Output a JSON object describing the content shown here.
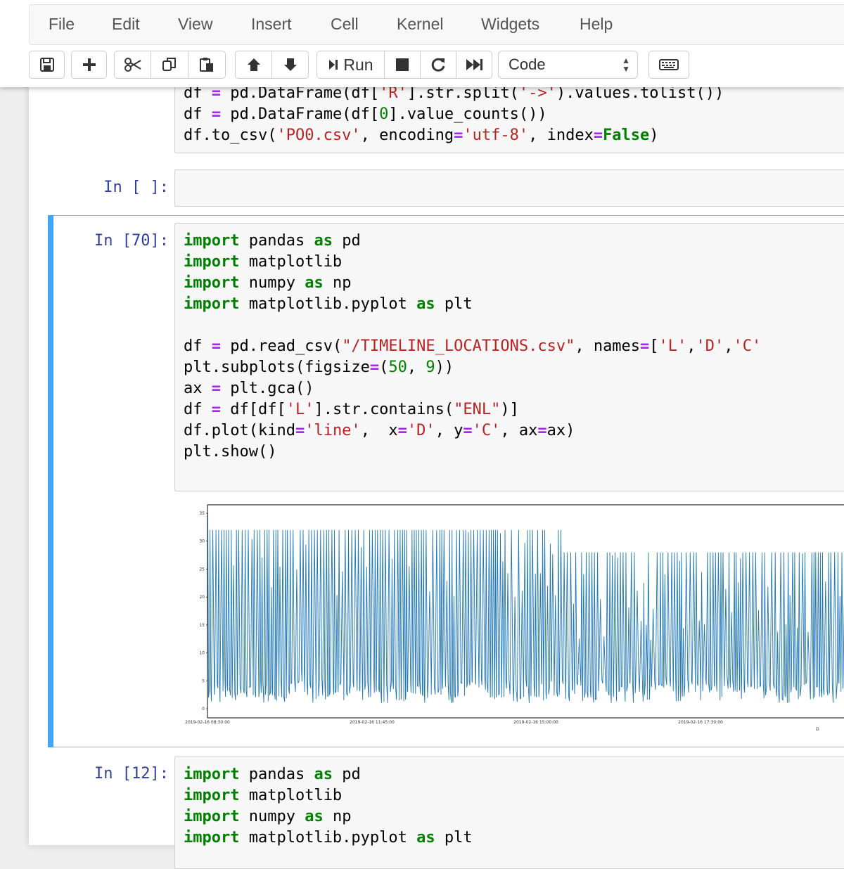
{
  "menu": [
    "File",
    "Edit",
    "View",
    "Insert",
    "Cell",
    "Kernel",
    "Widgets",
    "Help"
  ],
  "toolbar": {
    "run_label": "Run",
    "cell_type": "Code"
  },
  "icons": [
    "save-icon",
    "plus-icon",
    "cut-icon",
    "copy-icon",
    "paste-icon",
    "arrow-up-icon",
    "arrow-down-icon",
    "step-icon",
    "stop-icon",
    "restart-icon",
    "fast-forward-icon",
    "keyboard-icon"
  ],
  "cells": [
    {
      "prompt": "",
      "lines": [
        [
          [
            "t",
            "df "
          ],
          [
            "op",
            "="
          ],
          [
            "t",
            " pd.DataFrame(df["
          ],
          [
            "str",
            "'R'"
          ],
          [
            "t",
            "].str.split("
          ],
          [
            "str",
            "'->'"
          ],
          [
            "t",
            ").values.tolist())"
          ]
        ],
        [
          [
            "t",
            "df "
          ],
          [
            "op",
            "="
          ],
          [
            "t",
            " pd.DataFrame(df["
          ],
          [
            "num",
            "0"
          ],
          [
            "t",
            "].value_counts())"
          ]
        ],
        [
          [
            "t",
            "df.to_csv("
          ],
          [
            "str",
            "'PO0.csv'"
          ],
          [
            "t",
            ", encoding"
          ],
          [
            "op",
            "="
          ],
          [
            "str",
            "'utf-8'"
          ],
          [
            "t",
            ", index"
          ],
          [
            "op",
            "="
          ],
          [
            "kwc",
            "False"
          ],
          [
            "t",
            ")"
          ]
        ]
      ]
    },
    {
      "prompt": "In [ ]:",
      "lines": []
    },
    {
      "prompt": "In [70]:",
      "lines": [
        [
          [
            "kw",
            "import"
          ],
          [
            "t",
            " pandas "
          ],
          [
            "kw",
            "as"
          ],
          [
            "t",
            " pd"
          ]
        ],
        [
          [
            "kw",
            "import"
          ],
          [
            "t",
            " matplotlib"
          ]
        ],
        [
          [
            "kw",
            "import"
          ],
          [
            "t",
            " numpy "
          ],
          [
            "kw",
            "as"
          ],
          [
            "t",
            " np"
          ]
        ],
        [
          [
            "kw",
            "import"
          ],
          [
            "t",
            " matplotlib.pyplot "
          ],
          [
            "kw",
            "as"
          ],
          [
            "t",
            " plt"
          ]
        ],
        [
          [
            "t",
            ""
          ]
        ],
        [
          [
            "t",
            "df "
          ],
          [
            "op",
            "="
          ],
          [
            "t",
            " pd.read_csv("
          ],
          [
            "str",
            "\"/TIMELINE_LOCATIONS.csv\""
          ],
          [
            "t",
            ", names"
          ],
          [
            "op",
            "="
          ],
          [
            "t",
            "["
          ],
          [
            "str",
            "'L'"
          ],
          [
            "t",
            ","
          ],
          [
            "str",
            "'D'"
          ],
          [
            "t",
            ","
          ],
          [
            "str",
            "'C'"
          ]
        ],
        [
          [
            "t",
            "plt.subplots(figsize"
          ],
          [
            "op",
            "="
          ],
          [
            "t",
            "("
          ],
          [
            "num",
            "50"
          ],
          [
            "t",
            ", "
          ],
          [
            "num",
            "9"
          ],
          [
            "t",
            "))"
          ]
        ],
        [
          [
            "t",
            "ax "
          ],
          [
            "op",
            "="
          ],
          [
            "t",
            " plt.gca()"
          ]
        ],
        [
          [
            "t",
            "df "
          ],
          [
            "op",
            "="
          ],
          [
            "t",
            " df[df["
          ],
          [
            "str",
            "'L'"
          ],
          [
            "t",
            "].str.contains("
          ],
          [
            "str",
            "\"ENL\""
          ],
          [
            "t",
            ")]"
          ]
        ],
        [
          [
            "t",
            "df.plot(kind"
          ],
          [
            "op",
            "="
          ],
          [
            "str",
            "'line'"
          ],
          [
            "t",
            ",  x"
          ],
          [
            "op",
            "="
          ],
          [
            "str",
            "'D'"
          ],
          [
            "t",
            ", y"
          ],
          [
            "op",
            "="
          ],
          [
            "str",
            "'C'"
          ],
          [
            "t",
            ", ax"
          ],
          [
            "op",
            "="
          ],
          [
            "t",
            "ax)"
          ]
        ],
        [
          [
            "t",
            "plt.show()"
          ]
        ]
      ]
    },
    {
      "prompt": "In [12]:",
      "lines": [
        [
          [
            "kw",
            "import"
          ],
          [
            "t",
            " pandas "
          ],
          [
            "kw",
            "as"
          ],
          [
            "t",
            " pd"
          ]
        ],
        [
          [
            "kw",
            "import"
          ],
          [
            "t",
            " matplotlib"
          ]
        ],
        [
          [
            "kw",
            "import"
          ],
          [
            "t",
            " numpy "
          ],
          [
            "kw",
            "as"
          ],
          [
            "t",
            " np"
          ]
        ],
        [
          [
            "kw",
            "import"
          ],
          [
            "t",
            " matplotlib.pyplot "
          ],
          [
            "kw",
            "as"
          ],
          [
            "t",
            " plt"
          ]
        ]
      ]
    }
  ],
  "chart_data": {
    "type": "line",
    "xlabel": "D",
    "ylabel": "",
    "ylim": [
      0,
      35
    ],
    "yticks": [
      0,
      5,
      10,
      15,
      20,
      25,
      30,
      35
    ],
    "xtick_labels": [
      "2019-02-16 08:30:00",
      "2019-02-16 11:45:00",
      "2019-02-16 15:00:00",
      "2019-02-16 17:30:00"
    ],
    "series_color": "#1f77b4",
    "series": [
      {
        "name": "C",
        "pattern": "dense oscillation; peaks near 32 until about 15:30, then peaks near 28; troughs near 1",
        "first_value": 35
      }
    ]
  }
}
